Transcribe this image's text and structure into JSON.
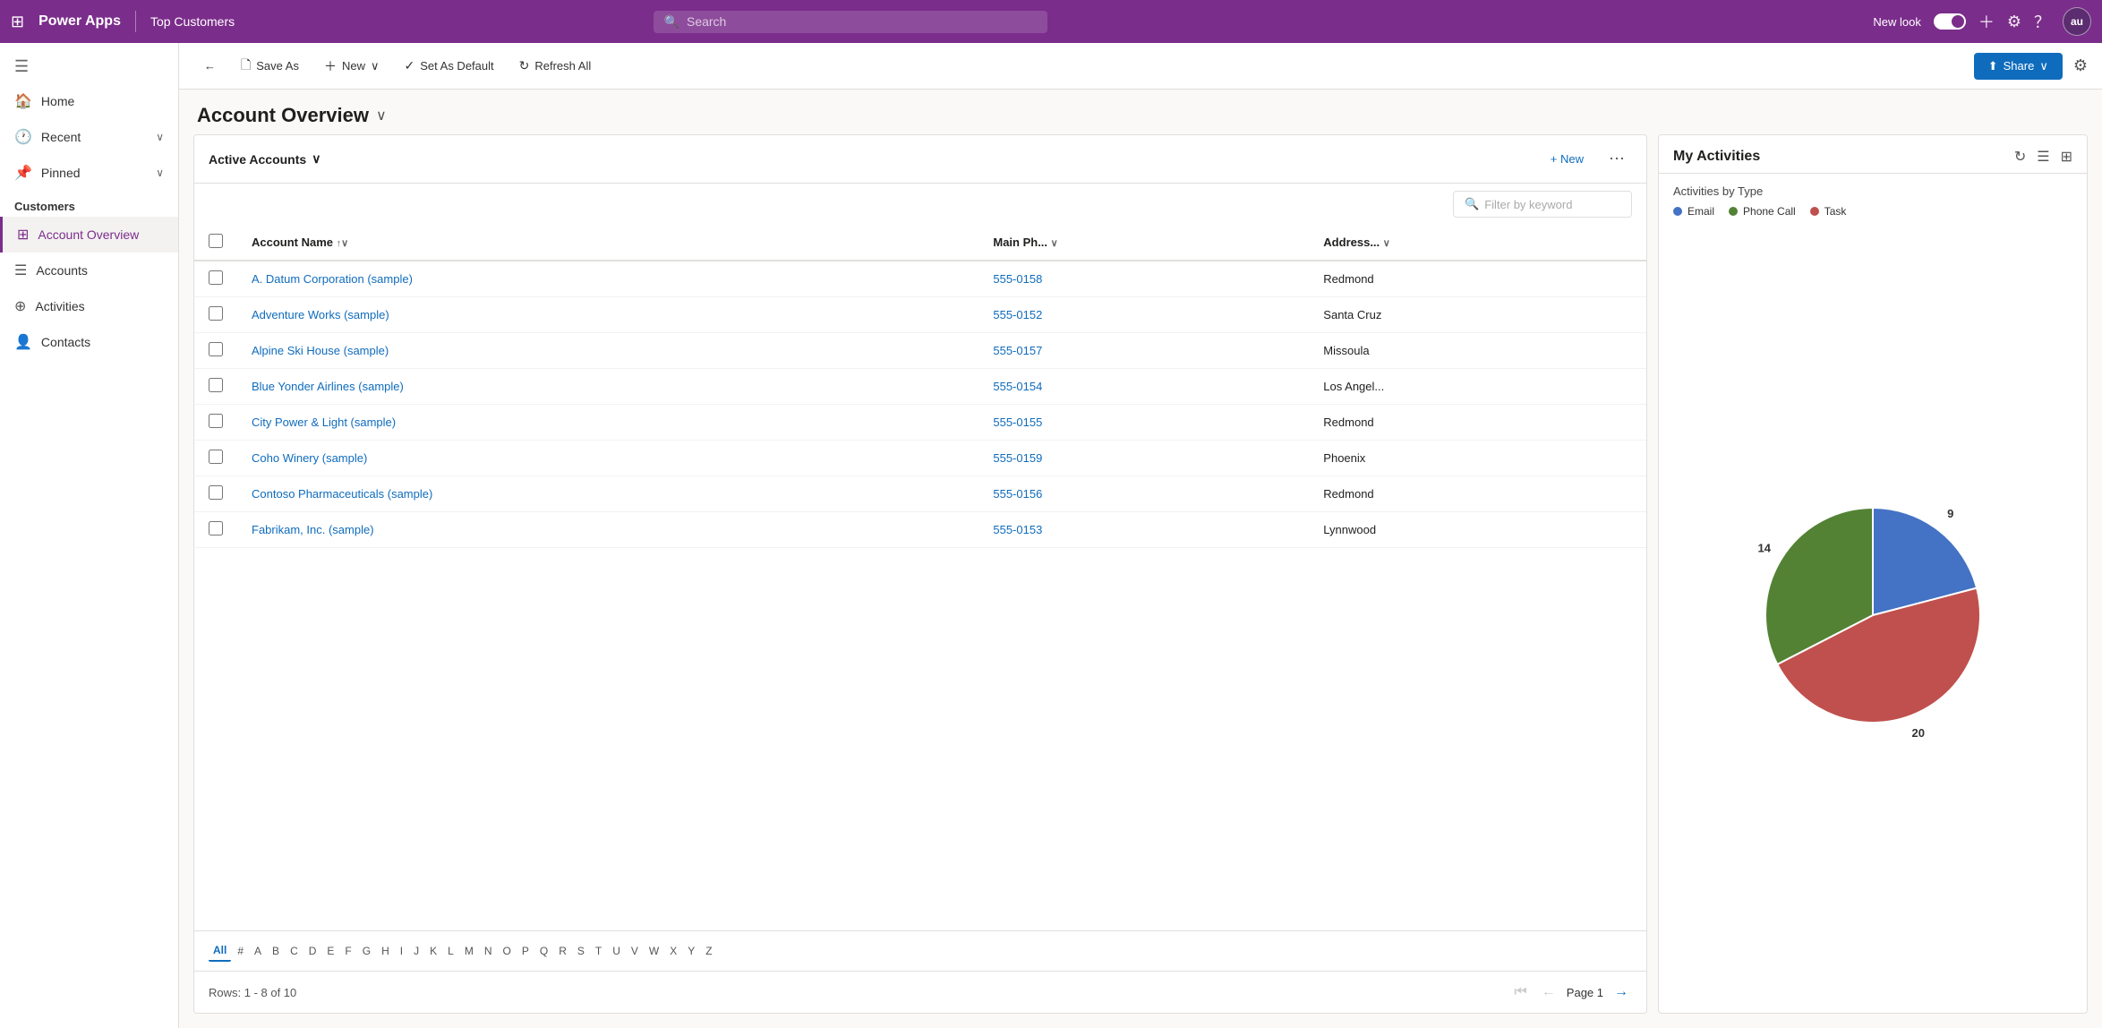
{
  "topnav": {
    "app_name": "Power Apps",
    "divider": "|",
    "page_name": "Top Customers",
    "search_placeholder": "Search",
    "new_look_label": "New look",
    "user_initials": "au"
  },
  "toolbar": {
    "back_label": "←",
    "save_as_label": "Save As",
    "new_label": "New",
    "new_chevron": "∨",
    "set_default_label": "Set As Default",
    "refresh_label": "Refresh All",
    "share_label": "Share",
    "share_chevron": "∨"
  },
  "page": {
    "title": "Account Overview",
    "chevron": "∨"
  },
  "accounts_panel": {
    "view_name": "Active Accounts",
    "view_chevron": "∨",
    "new_btn": "+ New",
    "filter_placeholder": "Filter by keyword",
    "columns": [
      {
        "label": "Account Name",
        "sort": "↑∨"
      },
      {
        "label": "Main Ph...",
        "sort": "∨"
      },
      {
        "label": "Address...",
        "sort": "∨"
      }
    ],
    "rows": [
      {
        "name": "A. Datum Corporation (sample)",
        "phone": "555-0158",
        "address": "Redmond"
      },
      {
        "name": "Adventure Works (sample)",
        "phone": "555-0152",
        "address": "Santa Cruz"
      },
      {
        "name": "Alpine Ski House (sample)",
        "phone": "555-0157",
        "address": "Missoula"
      },
      {
        "name": "Blue Yonder Airlines (sample)",
        "phone": "555-0154",
        "address": "Los Angel..."
      },
      {
        "name": "City Power & Light (sample)",
        "phone": "555-0155",
        "address": "Redmond"
      },
      {
        "name": "Coho Winery (sample)",
        "phone": "555-0159",
        "address": "Phoenix"
      },
      {
        "name": "Contoso Pharmaceuticals (sample)",
        "phone": "555-0156",
        "address": "Redmond"
      },
      {
        "name": "Fabrikam, Inc. (sample)",
        "phone": "555-0153",
        "address": "Lynnwood"
      }
    ],
    "alphabet": [
      "All",
      "#",
      "A",
      "B",
      "C",
      "D",
      "E",
      "F",
      "G",
      "H",
      "I",
      "J",
      "K",
      "L",
      "M",
      "N",
      "O",
      "P",
      "Q",
      "R",
      "S",
      "T",
      "U",
      "V",
      "W",
      "X",
      "Y",
      "Z"
    ],
    "active_alpha": "All",
    "rows_info": "Rows: 1 - 8 of 10",
    "page_label": "Page 1"
  },
  "activities_panel": {
    "title": "My Activities",
    "subtitle": "Activities by Type",
    "legend": [
      {
        "label": "Email",
        "color": "#4472C4"
      },
      {
        "label": "Phone Call",
        "color": "#548235"
      },
      {
        "label": "Task",
        "color": "#C0504D"
      }
    ],
    "chart_data": [
      {
        "label": "Email",
        "value": 9,
        "color": "#4472C4",
        "pct": 21
      },
      {
        "label": "Task",
        "value": 20,
        "color": "#C0504D",
        "pct": 46
      },
      {
        "label": "Phone Call",
        "value": 14,
        "color": "#548235",
        "pct": 33
      }
    ]
  },
  "sidebar": {
    "items": [
      {
        "label": "Home",
        "icon": "🏠"
      },
      {
        "label": "Recent",
        "icon": "🕐",
        "has_chevron": true
      },
      {
        "label": "Pinned",
        "icon": "📌",
        "has_chevron": true
      }
    ],
    "section": "Customers",
    "nav_items": [
      {
        "label": "Account Overview",
        "icon": "⊞",
        "active": true
      },
      {
        "label": "Accounts",
        "icon": "☰"
      },
      {
        "label": "Activities",
        "icon": "⊕"
      },
      {
        "label": "Contacts",
        "icon": "👤"
      }
    ]
  },
  "colors": {
    "purple": "#7B2D8B",
    "blue": "#0F6CBD",
    "email": "#4472C4",
    "phonecall": "#548235",
    "task": "#C0504D"
  }
}
